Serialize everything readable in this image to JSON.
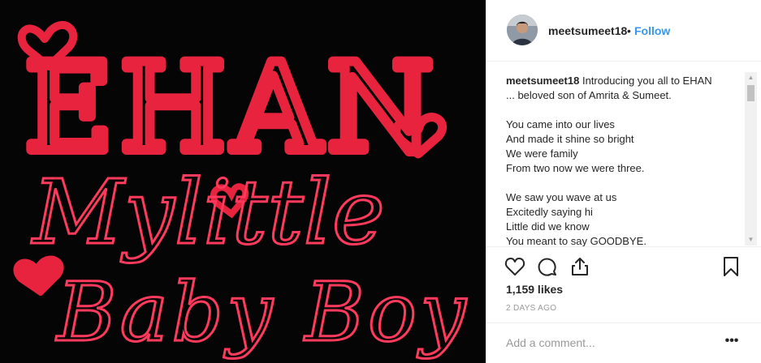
{
  "post": {
    "image_alt": "Handwritten red drawing on black background",
    "image_text": {
      "line1": "EHAN",
      "line2": "Mylittle",
      "line3": "Baby Boy"
    },
    "colors": {
      "ink": "#e8233d",
      "ink_thin": "#ff3a5c",
      "background": "#050505"
    }
  },
  "header": {
    "username": "meetsumeet18",
    "dot": "•",
    "follow_label": "Follow",
    "follow_color": "#3897f0"
  },
  "caption": {
    "username": "meetsumeet18",
    "lines": [
      "Introducing you all to EHAN",
      "... beloved son of Amrita & Sumeet.",
      "",
      "You came into our lives",
      "And made it shine so bright",
      "We were family",
      "From two now we were three.",
      "",
      "We saw you wave at us",
      "Excitedly saying hi",
      "Little did we know",
      "You meant to say GOODBYE."
    ]
  },
  "actions": {
    "icons": [
      "heart-icon",
      "comment-icon",
      "share-icon",
      "bookmark-icon"
    ]
  },
  "stats": {
    "likes": "1,159 likes",
    "time": "2 DAYS AGO"
  },
  "comment": {
    "placeholder": "Add a comment...",
    "more": "•••"
  }
}
